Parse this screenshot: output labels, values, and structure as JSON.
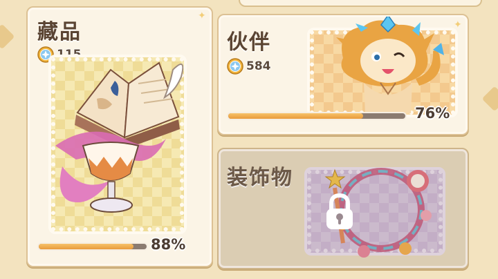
{
  "colors": {
    "accent_orange": "#e99b3b",
    "card_bg": "#fbf4e6",
    "card_border": "#dcc194",
    "track": "#8b7b70",
    "title_text": "#5a4432"
  },
  "cards": {
    "collection": {
      "title": "藏品",
      "coin_icon": "star-coin-icon",
      "coin_count": "115",
      "progress_percent": 88,
      "progress_label": "88%",
      "art": [
        "open-book-with-quill",
        "magic-goblet-with-ribbon"
      ]
    },
    "partner": {
      "title": "伙伴",
      "coin_icon": "star-coin-icon",
      "coin_count": "584",
      "progress_percent": 76,
      "progress_label": "76%",
      "art": [
        "lion-cub-character"
      ]
    },
    "decoration": {
      "title": "装饰物",
      "locked": true,
      "lock_icon": "padlock-icon",
      "art": [
        "floral-wreath-frame"
      ]
    }
  }
}
